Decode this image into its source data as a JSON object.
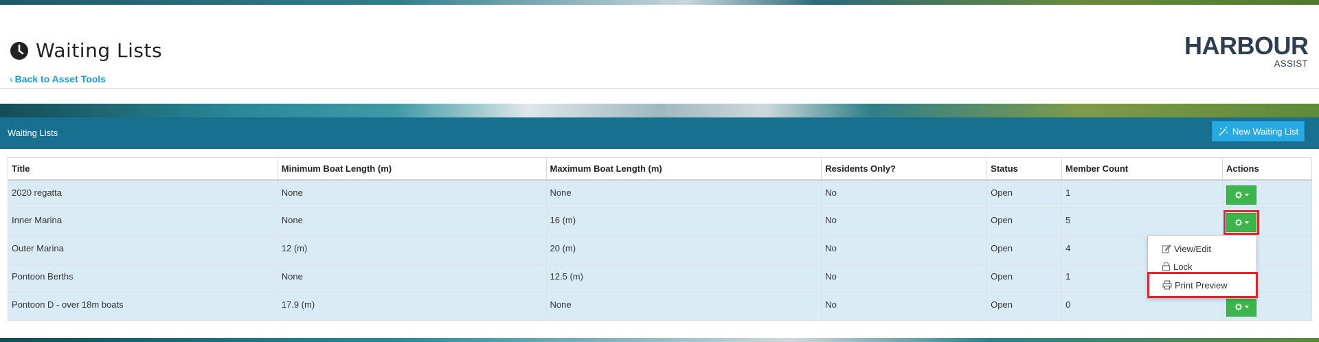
{
  "header": {
    "title": "Waiting Lists",
    "back_link": "Back to Asset Tools",
    "logo_main": "HARBOUR",
    "logo_sub": "ASSIST"
  },
  "panel": {
    "title": "Waiting Lists",
    "new_button": "New Waiting List"
  },
  "table": {
    "columns": [
      "Title",
      "Minimum Boat Length (m)",
      "Maximum Boat Length (m)",
      "Residents Only?",
      "Status",
      "Member Count",
      "Actions"
    ],
    "rows": [
      {
        "title": "2020 regatta",
        "min": "None",
        "max": "None",
        "residents": "No",
        "status": "Open",
        "count": "1"
      },
      {
        "title": "Inner Marina",
        "min": "None",
        "max": "16 (m)",
        "residents": "No",
        "status": "Open",
        "count": "5"
      },
      {
        "title": "Outer Marina",
        "min": "12 (m)",
        "max": "20 (m)",
        "residents": "No",
        "status": "Open",
        "count": "4"
      },
      {
        "title": "Pontoon Berths",
        "min": "None",
        "max": "12.5 (m)",
        "residents": "No",
        "status": "Open",
        "count": "1"
      },
      {
        "title": "Pontoon D - over 18m boats",
        "min": "17.9 (m)",
        "max": "None",
        "residents": "No",
        "status": "Open",
        "count": "0"
      }
    ]
  },
  "dropdown": {
    "view_edit": "View/Edit",
    "lock": "Lock",
    "print_preview": "Print Preview"
  },
  "colors": {
    "panel_header": "#17708f",
    "row_bg": "#d9ebf5",
    "action_button": "#3cb64a",
    "new_button": "#29a9e1",
    "highlight": "#e0262b",
    "link": "#1a9ad6"
  },
  "icons": [
    "clock-icon",
    "chevron-left-icon",
    "magic-wand-icon",
    "gear-icon",
    "caret-down-icon",
    "edit-icon",
    "lock-icon",
    "print-icon"
  ]
}
